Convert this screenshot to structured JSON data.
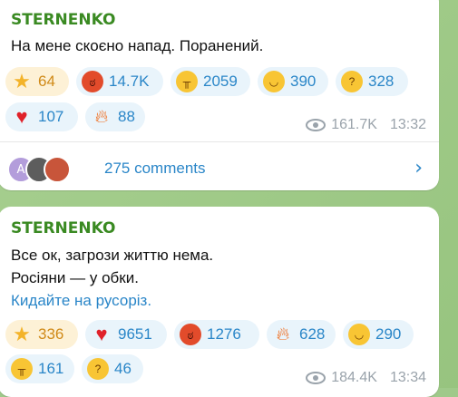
{
  "messages": [
    {
      "sender": "STERNENKO",
      "lines": [
        "На мене скоєно напад. Поранений."
      ],
      "reactions": [
        {
          "emoji": "star-emoji",
          "count": "64",
          "selected": true
        },
        {
          "emoji": "angry-face-emoji",
          "count": "14.7K"
        },
        {
          "emoji": "crying-face-emoji",
          "count": "2059"
        },
        {
          "emoji": "grinning-face-emoji",
          "count": "390"
        },
        {
          "emoji": "thinking-face-emoji",
          "count": "328"
        },
        {
          "emoji": "red-heart-emoji",
          "count": "107"
        },
        {
          "emoji": "fire-emoji",
          "count": "88"
        }
      ],
      "views": "161.7K",
      "time": "13:32",
      "comments": {
        "avatar_letter": "A",
        "label": "275 comments"
      }
    },
    {
      "sender": "STERNENKO",
      "lines": [
        "Все ок, загрози життю нема.",
        "Росіяни — у  обки."
      ],
      "link_line": "Кидайте на русоріз.",
      "reactions": [
        {
          "emoji": "star-emoji",
          "count": "336",
          "selected": true
        },
        {
          "emoji": "red-heart-emoji",
          "count": "9651"
        },
        {
          "emoji": "angry-face-emoji",
          "count": "1276"
        },
        {
          "emoji": "fire-emoji",
          "count": "628"
        },
        {
          "emoji": "grinning-face-emoji",
          "count": "290"
        },
        {
          "emoji": "crying-face-emoji",
          "count": "161"
        },
        {
          "emoji": "thinking-face-emoji",
          "count": "46"
        }
      ],
      "views": "184.4K",
      "time": "13:34"
    }
  ],
  "colors": {
    "sender": "#3a8a22",
    "link": "#2a86c8",
    "chip_bg": "#e9f4fb",
    "chip_selected_bg": "#fdf1d6",
    "background": "#9fc98a"
  }
}
